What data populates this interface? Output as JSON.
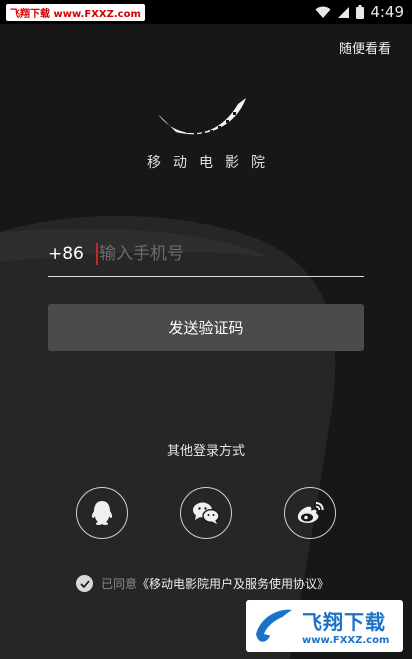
{
  "status_bar": {
    "watermark": "飞翔下载 www.FXXZ.com",
    "time": "4:49",
    "icons": [
      "wifi-icon",
      "signal-icon",
      "battery-icon"
    ]
  },
  "header": {
    "skip_label": "随便看看"
  },
  "brand": {
    "app_name": "移动电影院",
    "logo_icon": "film-reel-smile-icon"
  },
  "login": {
    "country_code": "+86",
    "phone_placeholder": "输入手机号",
    "send_code_label": "发送验证码"
  },
  "other_login": {
    "title": "其他登录方式",
    "providers": [
      "qq-icon",
      "wechat-icon",
      "weibo-icon"
    ]
  },
  "agreement": {
    "prefix": "已同意",
    "link": "《移动电影院用户及服务使用协议》",
    "checked": true
  },
  "watermark_badge": {
    "title": "飞翔下载",
    "url": "www.FXXZ.com"
  },
  "colors": {
    "background": "#171717",
    "button": "#4b4b4b",
    "cursor": "#c62828",
    "watermark_blue": "#1a73c8"
  }
}
